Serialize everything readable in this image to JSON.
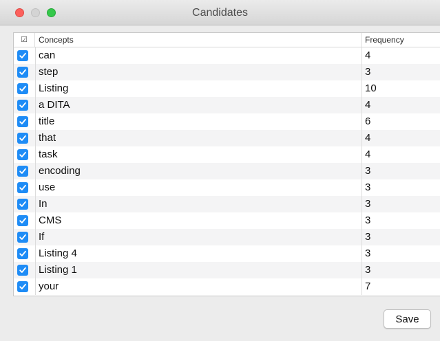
{
  "window": {
    "title": "Candidates"
  },
  "table": {
    "headers": {
      "check": "☑",
      "concepts": "Concepts",
      "frequency": "Frequency"
    },
    "rows": [
      {
        "checked": true,
        "concept": "can",
        "frequency": "4"
      },
      {
        "checked": true,
        "concept": "step",
        "frequency": "3"
      },
      {
        "checked": true,
        "concept": "Listing",
        "frequency": "10"
      },
      {
        "checked": true,
        "concept": "a DITA",
        "frequency": "4"
      },
      {
        "checked": true,
        "concept": "title",
        "frequency": "6"
      },
      {
        "checked": true,
        "concept": "that",
        "frequency": "4"
      },
      {
        "checked": true,
        "concept": "task",
        "frequency": "4"
      },
      {
        "checked": true,
        "concept": "encoding",
        "frequency": "3"
      },
      {
        "checked": true,
        "concept": "use",
        "frequency": "3"
      },
      {
        "checked": true,
        "concept": "In",
        "frequency": "3"
      },
      {
        "checked": true,
        "concept": "CMS",
        "frequency": "3"
      },
      {
        "checked": true,
        "concept": "If",
        "frequency": "3"
      },
      {
        "checked": true,
        "concept": "Listing 4",
        "frequency": "3"
      },
      {
        "checked": true,
        "concept": "Listing 1",
        "frequency": "3"
      },
      {
        "checked": true,
        "concept": "your",
        "frequency": "7"
      }
    ]
  },
  "footer": {
    "save_label": "Save"
  },
  "colors": {
    "checkbox": "#1e8cf6",
    "close": "#fc605c",
    "minimize": "#d4d4d4",
    "zoom": "#34c84a"
  }
}
